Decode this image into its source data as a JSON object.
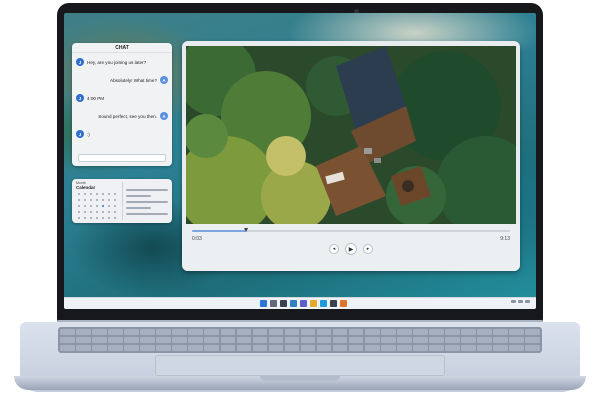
{
  "chat": {
    "title": "CHAT",
    "messages": [
      {
        "side": "left",
        "avatar": "J",
        "text": "Hey, are you joining us later?"
      },
      {
        "side": "right",
        "avatar": "A",
        "text": "Absolutely! What time?"
      },
      {
        "side": "left",
        "avatar": "J",
        "text": "4:00 PM"
      },
      {
        "side": "right",
        "avatar": "A",
        "text": "Sound perfect, see you then."
      },
      {
        "side": "left",
        "avatar": "J",
        "text": ":)"
      }
    ],
    "input_placeholder": ""
  },
  "calendar": {
    "header": "Month",
    "title": "Calendar"
  },
  "player": {
    "elapsed": "0:03",
    "duration": "9:13",
    "progress": 0.17,
    "controls": {
      "previous_icon": "rewind-icon",
      "play_icon": "play-icon",
      "next_icon": "forward-icon",
      "previous_glyph": "◂",
      "play_glyph": "▶",
      "next_glyph": "▸"
    }
  },
  "taskbar": {
    "icons": [
      {
        "name": "start-icon",
        "color": "#2b74d8"
      },
      {
        "name": "search-icon",
        "color": "#5f6b7a"
      },
      {
        "name": "task-view-icon",
        "color": "#3a4250"
      },
      {
        "name": "widgets-icon",
        "color": "#2e7fc4"
      },
      {
        "name": "chat-app-icon",
        "color": "#5b5fc7"
      },
      {
        "name": "file-explorer-icon",
        "color": "#e3a82b"
      },
      {
        "name": "browser-icon",
        "color": "#1e9ad6"
      },
      {
        "name": "store-icon",
        "color": "#3a4250"
      },
      {
        "name": "media-player-icon",
        "color": "#e0742a"
      }
    ]
  }
}
